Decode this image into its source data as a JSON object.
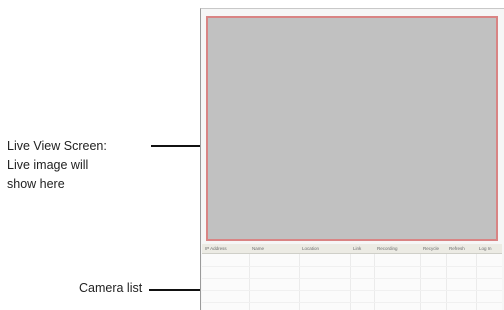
{
  "callouts": {
    "live_view": {
      "line1": "Live View Screen:",
      "line2": "Live image will",
      "line3": "show here"
    },
    "camera_list": {
      "label": "Camera list"
    }
  },
  "camera_list": {
    "columns": [
      "IP Address",
      "Name",
      "Location",
      "Link",
      "Recording",
      "Recycle",
      "Refresh",
      "Log In"
    ]
  },
  "colors": {
    "live_view_fill": "#c1c1c1",
    "live_view_border": "#d98484",
    "callout_line": "#111111"
  }
}
